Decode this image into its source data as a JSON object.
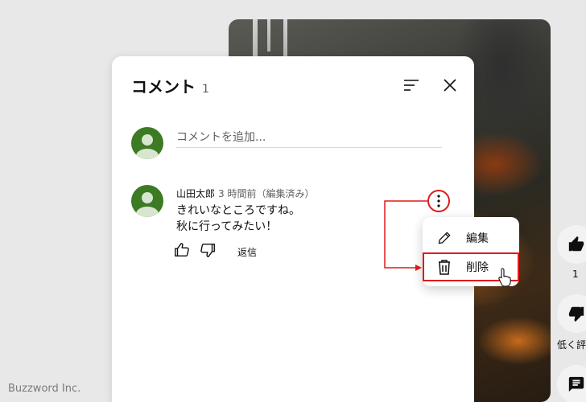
{
  "panel": {
    "title": "コメント",
    "count": "1",
    "sort_icon": "sort-icon",
    "close_icon": "close-icon"
  },
  "add_comment": {
    "placeholder": "コメントを追加..."
  },
  "comment": {
    "author": "山田太郎",
    "time": "3 時間前（編集済み）",
    "line1": "きれいなところですね。",
    "line2": "秋に行ってみたい！",
    "reply_label": "返信",
    "like_icon": "thumbs-up-outline-icon",
    "dislike_icon": "thumbs-down-outline-icon",
    "more_icon": "more-vertical-icon"
  },
  "menu": {
    "items": [
      {
        "label": "編集",
        "icon": "pencil-icon"
      },
      {
        "label": "削除",
        "icon": "trash-icon"
      }
    ]
  },
  "rail": {
    "like_count": "1",
    "dislike_label": "低く評"
  },
  "watermark": "Buzzword Inc.",
  "colors": {
    "accent_red": "#e01a1a",
    "avatar_green": "#3c7a23",
    "panel_bg": "#ffffff",
    "page_bg": "#e8e8e8"
  }
}
